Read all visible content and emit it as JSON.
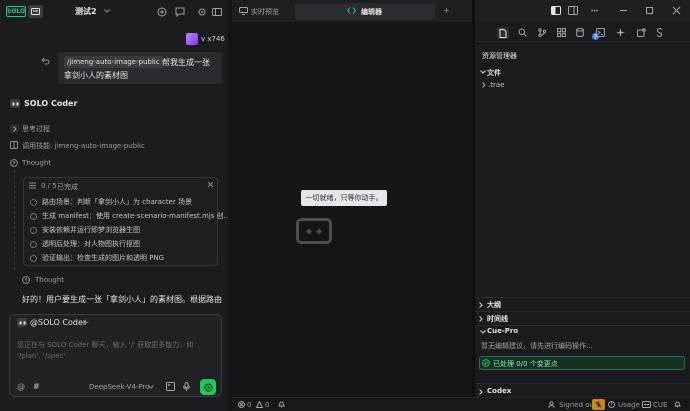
{
  "app": {
    "logo_text": "SOLO",
    "project_name": "测试2"
  },
  "user": {
    "name": "v x746"
  },
  "message": {
    "tag": "/jimeng-auto-image-public",
    "text_line1": "帮我生成一张",
    "text_line2": "拿剑小人的素材图"
  },
  "agent": {
    "name": "SOLO Coder",
    "think_label": "思考过程",
    "skill_prefix": "调用技能:",
    "skill_name": "jimeng-auto-image-public",
    "thought_label": "Thought",
    "thought_label2": "Thought"
  },
  "tasks": {
    "progress": "0 / 5",
    "status": "已完成",
    "items": [
      {
        "text": "路由场景：判断「拿剑小人」为 character 场景"
      },
      {
        "text": "生成 manifest：使用 create-scenario-manifest.mjs 创..."
      },
      {
        "text": "安装依赖并运行即梦浏览器生图"
      },
      {
        "text": "透明后处理：对人物图执行抠图"
      },
      {
        "text": "验证输出：检查生成的图片和透明 PNG"
      }
    ]
  },
  "reply": {
    "text": "好的！用户要生成一张「拿剑小人」的素材图。根据路由"
  },
  "composer": {
    "mention": "@SOLO Coder",
    "placeholder_line1": "您正在与 SOLO Coder 聊天，输入 '/' 获取更多能力，如",
    "placeholder_line2": "'/plan', '/spec'",
    "model": "DeepSeek-V4-Pro"
  },
  "center": {
    "tab_preview": "实时预览",
    "tab_editor": "编辑器",
    "tab_add": "+",
    "empty_text": "一切就绪，只等你动手。"
  },
  "explorer": {
    "title": "资源管理器",
    "files_label": "文件",
    "folder": ".trae",
    "outline": "大纲",
    "timeline": "时间线",
    "cuepro": "Cue-Pro",
    "cuepro_hint": "暂无编辑建议，请先进行编码操作...",
    "cuepro_status": "已处理 0/0 个变更点",
    "codex": "Codex",
    "badge": "1"
  },
  "status": {
    "errors": "0",
    "warnings": "0",
    "signed_out": "Signed out",
    "usage": "Usage",
    "cue": "CUE"
  },
  "colors": {
    "accent": "#22c55e",
    "brand": "#20c997",
    "badge": "#3b82f6"
  }
}
